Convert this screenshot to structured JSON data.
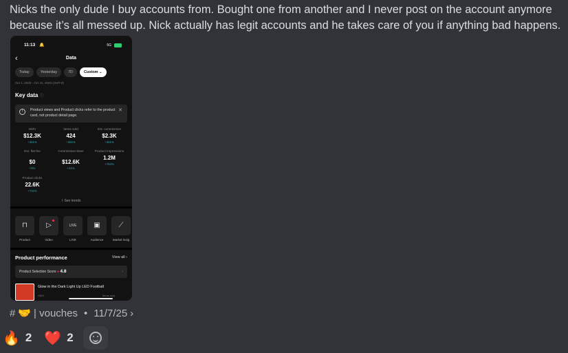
{
  "message": {
    "text": "Nicks the only dude I buy accounts from. Bought one from another and I never post on the account anymore because it’s all messed up. Nick actually has legit accounts and he takes care of you if anything bad happens."
  },
  "phone": {
    "status": {
      "time": "11:13",
      "network": "5G"
    },
    "nav": {
      "back_icon": "chevron-left-icon",
      "title": "Data"
    },
    "chips": [
      "Today",
      "Yesterday",
      "7D",
      "Custom ⌄"
    ],
    "date_range": "Oct 1, 2025 - Oct 31, 2025 (GMT-8)",
    "key_data": {
      "title": "Key data",
      "info": "ⓘ"
    },
    "notice": {
      "text": "Product views and Product clicks refer to the product card, not product detail page.",
      "close": "✕"
    },
    "metrics": [
      {
        "label": "GMV",
        "value": "$12.3K",
        "change": "+361%"
      },
      {
        "label": "Items sold",
        "value": "424",
        "change": "+361%"
      },
      {
        "label": "Est. commission",
        "value": "$2.3K",
        "change": "+361%"
      },
      {
        "label": "Est. flat fee",
        "value": "$0",
        "change": "+0%"
      },
      {
        "label": "Commission base",
        "value": "$12.6K",
        "change": "+41%"
      },
      {
        "label": "Product impressions",
        "value": "1.2M",
        "change": "+763%"
      },
      {
        "label": "Product clicks",
        "value": "22.6K",
        "change": "+732%"
      }
    ],
    "see_trends": "See trends",
    "tools": [
      {
        "icon": "bag-icon",
        "label": "Product"
      },
      {
        "icon": "play-icon",
        "label": "Video"
      },
      {
        "icon": "live-icon",
        "label": "LIVE"
      },
      {
        "icon": "audience-icon",
        "label": "Audience"
      },
      {
        "icon": "chart-icon",
        "label": "Market insig"
      }
    ],
    "performance": {
      "title": "Product performance",
      "view_all": "View all ›"
    },
    "score": {
      "label": "Product Selection Score",
      "value": "4.8"
    },
    "product": {
      "name": "Glow in the Dark Light Up LED Football",
      "gmv_label": "GMV",
      "items_label": "Items sold"
    }
  },
  "channel": {
    "name": "| vouches",
    "date": "11/7/25",
    "separator": "•"
  },
  "reactions": [
    {
      "emoji": "🔥",
      "count": "2"
    },
    {
      "emoji": "❤️",
      "count": "2"
    }
  ]
}
